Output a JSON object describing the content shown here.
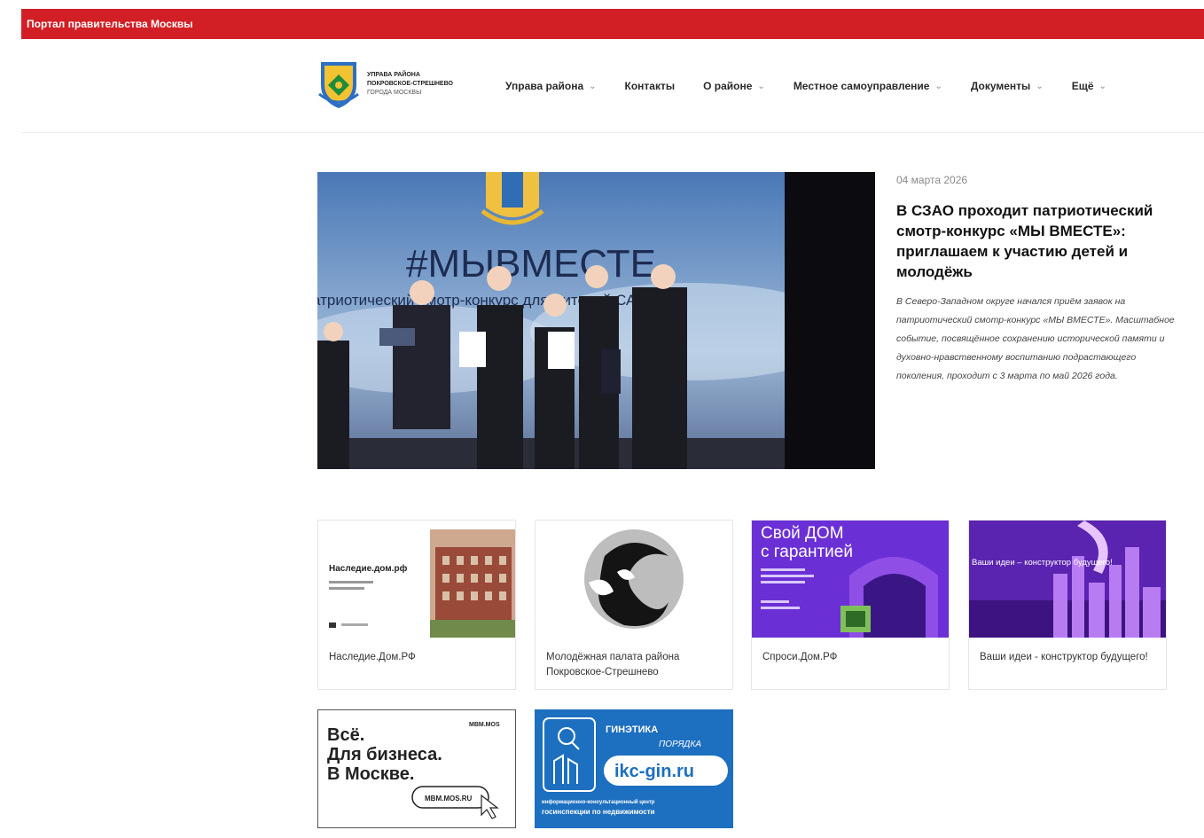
{
  "gov_bar": {
    "link": "Портал правительства Москвы"
  },
  "logo": {
    "line1": "Управа района",
    "line2": "Покровское-Стрешнево",
    "line3": "города Москвы"
  },
  "nav": [
    {
      "label": "Управа района",
      "dropdown": true
    },
    {
      "label": "Контакты",
      "dropdown": false
    },
    {
      "label": "О районе",
      "dropdown": true
    },
    {
      "label": "Местное самоуправление",
      "dropdown": true
    },
    {
      "label": "Документы",
      "dropdown": true
    },
    {
      "label": "Ещё",
      "dropdown": true
    }
  ],
  "hero": {
    "image_text": "#МЫВМЕСТЕ",
    "image_subtext": "атриотический смотр-конкурс для жителей САО"
  },
  "news": {
    "date": "04 марта 2026",
    "title": "В СЗАО проходит патриотический смотр-конкурс «МЫ ВМЕСТЕ»: приглашаем к участию детей и молодёжь",
    "lead": "В Северо-Западном округе начался приём заявок на патриотический смотр-конкурс «МЫ ВМЕСТЕ». Масштабное событие, посвящённое сохранению исторической памяти и духовно-нравственному воспитанию подрастающего поколения, проходит с 3 марта по май 2026 года."
  },
  "cards": [
    {
      "caption": "Наследие.Дом.РФ",
      "pic_title": "Наследие.дом.рф"
    },
    {
      "caption": "Молодёжная палата района Покровское-Стрешнево"
    },
    {
      "caption": "Спроси.Дом.РФ",
      "pic_title_1": "Свой ДОМ",
      "pic_title_2": "с гарантией"
    },
    {
      "caption": "Ваши идеи - конструктор будущего!",
      "pic_title": "Ваши идеи – конструктор будущего!"
    }
  ],
  "banners": [
    {
      "line1": "Всё.",
      "line2": "Для бизнеса.",
      "line3": "В Москве.",
      "button": "MBM.MOS.RU",
      "brand": "MBM.MOS"
    },
    {
      "top1": "ГИНЭТИКА",
      "top2": "ПОРЯДКА",
      "url": "ikc-gin.ru",
      "bottom1": "информационно-консультационный центр",
      "bottom2": "госинспекции по недвижимости"
    }
  ],
  "colors": {
    "gov_red": "#d21f25",
    "accent_blue": "#1d6fbf",
    "accent_purple": "#6b2fd6"
  }
}
